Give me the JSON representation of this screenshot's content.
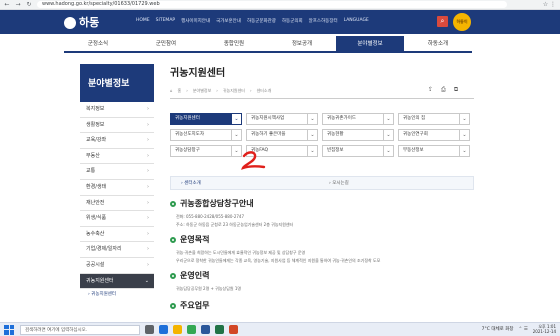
{
  "browser": {
    "url": "www.hadong.go.kr/specialty/01633/01729.web"
  },
  "header": {
    "logo_text": "하동",
    "utility": [
      "HOME",
      "SITEMAP",
      "행사이미지안내",
      "국가보훈안내",
      "하동군문화관광",
      "하동군의회",
      "알프스하동장터",
      "LANGUAGE"
    ],
    "mascot_label": "하동이"
  },
  "main_nav": [
    "군정소식",
    "군민참여",
    "종합민원",
    "정보공개",
    "분야별정보",
    "하동소개"
  ],
  "main_nav_active": 4,
  "sidebar": {
    "title": "분야별정보",
    "items": [
      "복지정보",
      "생활정보",
      "교육/강좌",
      "부동산",
      "교통",
      "환경/생태",
      "재난안전",
      "위생/식품",
      "농수축산",
      "기업/경제/일자리",
      "공공시설",
      "귀농지원센터"
    ],
    "active_index": 11,
    "sub_item": "귀농지원센터"
  },
  "content": {
    "title": "귀농지원센터",
    "breadcrumb": [
      "홈",
      "분야별정보",
      "귀농지원센터",
      "센터소개"
    ],
    "grid": [
      "귀농지원센터",
      "귀농지원시책사업",
      "귀농귀촌가이드",
      "귀농인의 집",
      "귀농선도지도자",
      "귀농하기 좋은마을",
      "귀농현황",
      "귀농인연구회",
      "귀농상담창구",
      "귀농FAQ",
      "빈집정보",
      "부동산정보"
    ],
    "grid_active": 0,
    "tabs": [
      "센터소개",
      "오시는길"
    ],
    "sections": [
      {
        "title": "귀농종합상담창구안내",
        "lines": [
          "전화: 055-880-2428/055-880-2747",
          "주소: 하동군 하동읍 군청로 23 하동군농업기술센터 2층 귀농지원센터"
        ]
      },
      {
        "title": "운영목적",
        "lines": [
          "귀농·귀촌을 희망하는 도시민들에게 효율적인 귀농정보 제공 및 상담창구 운영",
          "우리군으로 정착한 귀농인들에게는 각종 교육, 영농기술, 지원사업 등 체계적인 지원을 통하여 귀농·귀촌인의 조기정착 도모"
        ]
      },
      {
        "title": "운영인력",
        "lines": [
          "귀농담당공무원 2명 + 귀농상담원 1명"
        ]
      },
      {
        "title": "주요업무",
        "lines": []
      }
    ]
  },
  "taskbar": {
    "search_placeholder": "검색하려면 여기에 입력하십시오.",
    "weather": "7°C 대체로 화창",
    "time": "오후 1:01",
    "date": "2021-12-14"
  }
}
